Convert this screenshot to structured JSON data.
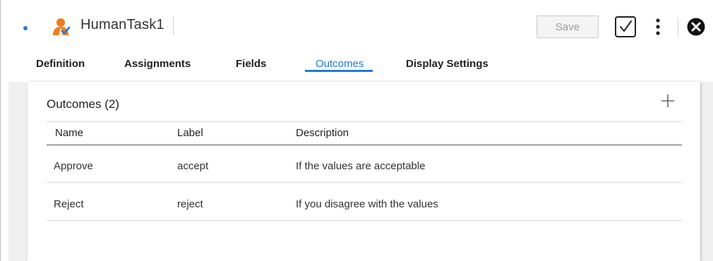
{
  "header": {
    "title": "HumanTask1",
    "save_label": "Save"
  },
  "tabs": [
    {
      "label": "Definition"
    },
    {
      "label": "Assignments"
    },
    {
      "label": "Fields"
    },
    {
      "label": "Outcomes",
      "active": true
    },
    {
      "label": "Display Settings"
    }
  ],
  "outcomes": {
    "title": "Outcomes (2)",
    "columns": [
      "Name",
      "Label",
      "Description"
    ],
    "rows": [
      {
        "name": "Approve",
        "label": "accept",
        "description": "If the values are acceptable"
      },
      {
        "name": "Reject",
        "label": "reject",
        "description": "If you disagree with the values"
      }
    ]
  },
  "colors": {
    "accent": "#1f7ad8",
    "task_icon": "#f07c1e"
  }
}
